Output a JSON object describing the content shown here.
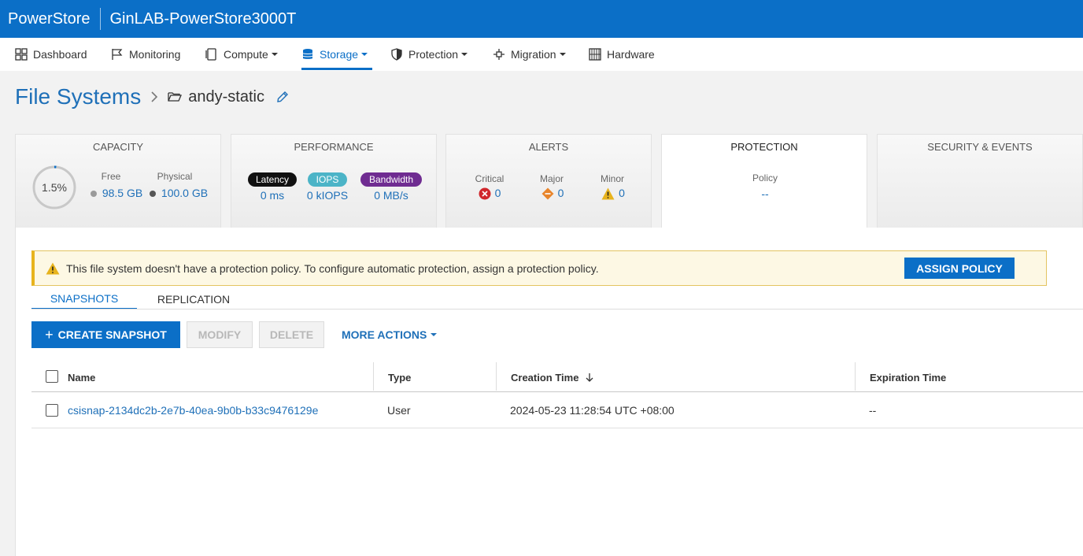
{
  "header": {
    "brand": "PowerStore",
    "system_name": "GinLAB-PowerStore3000T"
  },
  "nav": {
    "items": [
      {
        "label": "Dashboard"
      },
      {
        "label": "Monitoring"
      },
      {
        "label": "Compute"
      },
      {
        "label": "Storage"
      },
      {
        "label": "Protection"
      },
      {
        "label": "Migration"
      },
      {
        "label": "Hardware"
      }
    ],
    "active": "Storage"
  },
  "breadcrumb": {
    "root": "File Systems",
    "current": "andy-static"
  },
  "cards": {
    "capacity": {
      "title": "CAPACITY",
      "percent": "1.5%",
      "used_fraction": 0.015,
      "free_label": "Free",
      "free_value": "98.5 GB",
      "physical_label": "Physical",
      "physical_value": "100.0 GB"
    },
    "performance": {
      "title": "PERFORMANCE",
      "latency_label": "Latency",
      "latency_value": "0 ms",
      "iops_label": "IOPS",
      "iops_value": "0 kIOPS",
      "bandwidth_label": "Bandwidth",
      "bandwidth_value": "0 MB/s"
    },
    "alerts": {
      "title": "ALERTS",
      "critical_label": "Critical",
      "critical_value": "0",
      "major_label": "Major",
      "major_value": "0",
      "minor_label": "Minor",
      "minor_value": "0"
    },
    "protection": {
      "title": "PROTECTION",
      "policy_label": "Policy",
      "policy_value": "--"
    },
    "security": {
      "title": "SECURITY & EVENTS"
    }
  },
  "banner": {
    "message": "This file system doesn't have a protection policy. To configure automatic protection, assign a protection policy.",
    "button": "ASSIGN POLICY"
  },
  "tabs": [
    {
      "label": "SNAPSHOTS"
    },
    {
      "label": "REPLICATION"
    }
  ],
  "toolbar": {
    "create_label": "CREATE SNAPSHOT",
    "modify_label": "MODIFY",
    "delete_label": "DELETE",
    "more_label": "MORE ACTIONS"
  },
  "table": {
    "columns": {
      "name": "Name",
      "type": "Type",
      "creation": "Creation Time",
      "expiration": "Expiration Time"
    },
    "rows": [
      {
        "name": "csisnap-2134dc2b-2e7b-40ea-9b0b-b33c9476129e",
        "type": "User",
        "creation": "2024-05-23 11:28:54 UTC +08:00",
        "expiration": "--"
      }
    ]
  },
  "colors": {
    "brand_blue": "#0b6fc7",
    "link_blue": "#1f70b8",
    "warning_yellow": "#e7b31d",
    "critical_red": "#d0262b",
    "major_orange": "#e8852b",
    "latency_pill": "#111111",
    "iops_pill": "#4cb4c7",
    "bandwidth_pill": "#6f2c91"
  }
}
